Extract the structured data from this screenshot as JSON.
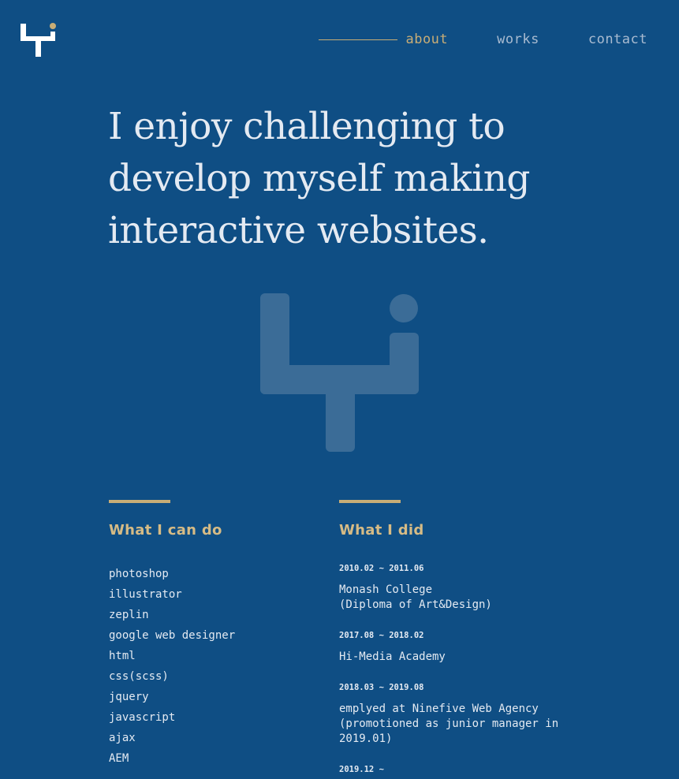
{
  "colors": {
    "background": "#0f4e84",
    "accent": "#c8ad76",
    "text": "#e4eaf2",
    "nav_text": "#a9bbd0",
    "watermark": "#3b6c97"
  },
  "header": {
    "logo_icon": "yi-logo-icon",
    "nav": [
      {
        "label": "about",
        "active": true
      },
      {
        "label": "works",
        "active": false
      },
      {
        "label": "contact",
        "active": false
      }
    ]
  },
  "hero": {
    "headline": "I enjoy challenging to develop myself making interactive websites.",
    "mark_icon": "yi-logo-icon"
  },
  "skills": {
    "title": "What I can do",
    "items": [
      "photoshop",
      "illustrator",
      "zeplin",
      "google web designer",
      "html",
      "css(scss)",
      "jquery",
      "javascript",
      "ajax",
      "AEM"
    ]
  },
  "history": {
    "title": "What I did",
    "entries": [
      {
        "date": "2010.02 ~ 2011.06",
        "description": "Monash College\n(Diploma of Art&Design)"
      },
      {
        "date": "2017.08 ~ 2018.02",
        "description": "Hi-Media Academy"
      },
      {
        "date": "2018.03 ~ 2019.08",
        "description": "emplyed at Ninefive Web Agency\n(promotioned as junior manager in 2019.01)"
      },
      {
        "date": "2019.12 ~",
        "description": ""
      }
    ]
  }
}
